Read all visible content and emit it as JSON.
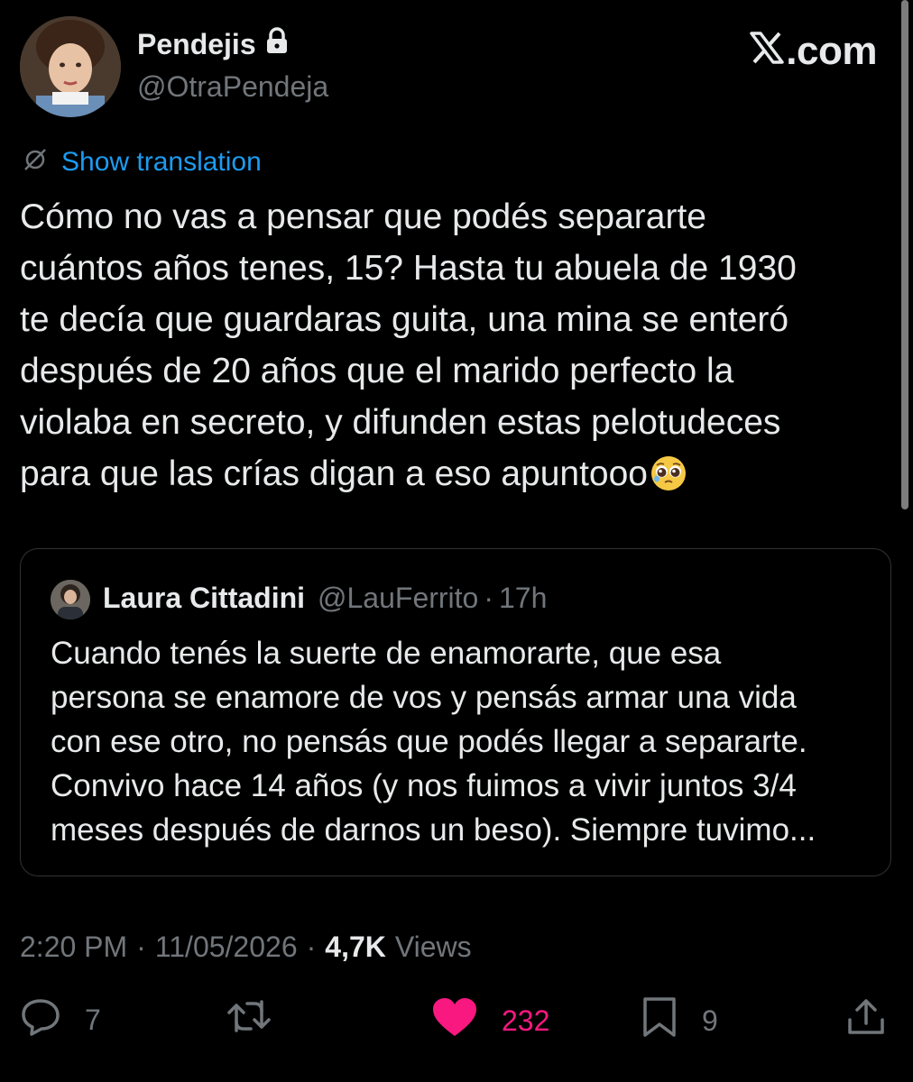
{
  "header": {
    "display_name": "Pendejis",
    "handle": "@OtraPendeja",
    "site_label": ".com",
    "icons": {
      "lock": "lock-icon",
      "x_logo": "x-logo-icon"
    }
  },
  "translation": {
    "label": "Show translation",
    "icon": "globe-slash-icon"
  },
  "tweet": {
    "text": "Cómo no vas a pensar que podés separarte\ncuántos años tenes, 15? Hasta tu abuela de 1930\nte decía que guardaras guita, una mina se enteró\ndespués de 20 años que el marido perfecto la\nviolaba en secreto, y difunden estas pelotudeces\npara que las crías digan a eso apuntooo",
    "emoji": "pleading-face-emoji"
  },
  "quote": {
    "name": "Laura Cittadini",
    "handle": "@LauFerrito",
    "separator": "·",
    "time": "17h",
    "text": "Cuando tenés la suerte de enamorarte, que esa\npersona se enamore de vos y pensás armar una vida\ncon ese otro, no pensás que podés llegar a separarte.\nConvivo hace 14 años  (y nos fuimos a vivir juntos 3/4\nmeses después de darnos un beso). Siempre tuvimo..."
  },
  "meta": {
    "time": "2:20 PM",
    "separator": "·",
    "date": "11/05/2026",
    "views_count": "4,7K",
    "views_label": "Views"
  },
  "actions": {
    "replies": "7",
    "retweets": "",
    "likes": "232",
    "bookmarks": "9",
    "icons": [
      "reply-icon",
      "retweet-icon",
      "heart-icon",
      "bookmark-icon",
      "share-icon"
    ]
  },
  "colors": {
    "background": "#000000",
    "text": "#e7e9ea",
    "secondary": "#71767b",
    "link": "#1d9bf0",
    "like": "#f91880",
    "border": "#2f3336"
  }
}
